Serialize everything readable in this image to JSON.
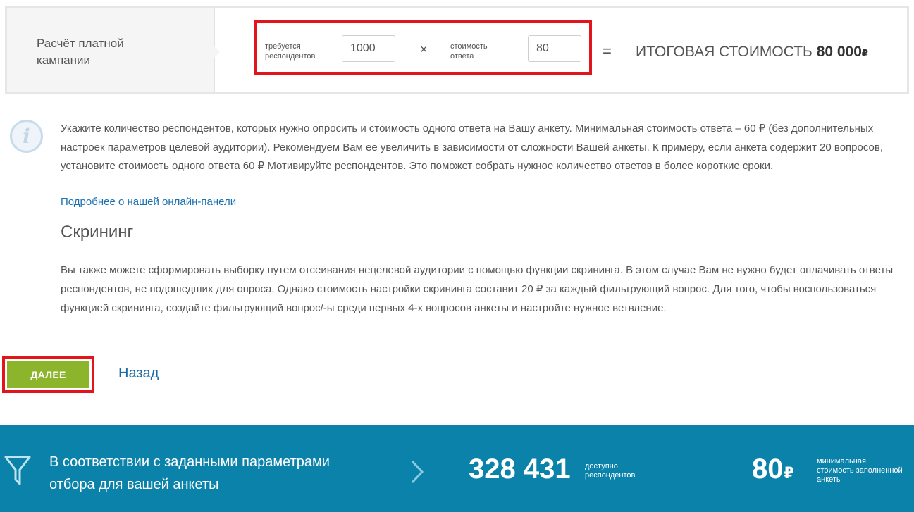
{
  "calc": {
    "title": "Расчёт платной кампании",
    "respondents_label": "требуется респондентов",
    "respondents_value": "1000",
    "times": "×",
    "cost_label": "стоимость ответа",
    "cost_value": "80",
    "equals": "=",
    "total_label": "ИТОГОВАЯ СТОИМОСТЬ",
    "total_amount": "80 000",
    "total_currency": "₽"
  },
  "info": {
    "icon": "info-icon",
    "text": "Укажите количество респондентов, которых нужно опросить и стоимость одного ответа на Вашу анкету. Минимальная стоимость ответа – 60 ₽ (без дополнительных настроек параметров целевой аудитории). Рекомендуем Вам ее увеличить в зависимости от сложности Вашей анкеты. К примеру, если анкета содержит 20 вопросов, установите стоимость одного ответа 60 ₽ Мотивируйте респондентов. Это поможет собрать нужное количество ответов в более короткие сроки.",
    "link": "Подробнее о нашей онлайн-панели"
  },
  "screening": {
    "title": "Скрининг",
    "text": "Вы также можете сформировать выборку путем отсеивания нецелевой аудитории с помощью функции скрининга. В этом случае Вам не нужно будет оплачивать ответы респондентов, не подошедших для опроса. Однако стоимость настройки скрининга составит 20 ₽ за каждый фильтрующий вопрос. Для того, чтобы воспользоваться функцией скрининга, создайте фильтрующий вопрос/-ы среди первых 4-х вопросов анкеты и настройте нужное ветвление."
  },
  "actions": {
    "next_label": "ДАЛЕЕ",
    "back_label": "Назад"
  },
  "bottom": {
    "text": "В соответствии с заданными параметрами отбора для вашей анкеты",
    "available_count": "328 431",
    "available_label": "доступно респондентов",
    "min_price": "80",
    "min_price_currency": "₽",
    "min_price_label": "минимальная стоимость заполненной анкеты"
  },
  "colors": {
    "accent_green": "#8db52b",
    "bottom_bar": "#0a82aa",
    "highlight_red": "#e2141c",
    "link_blue": "#1a72b0"
  }
}
